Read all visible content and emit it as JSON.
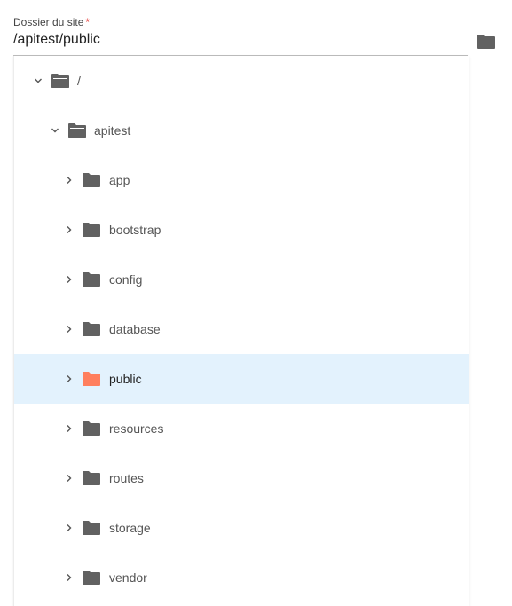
{
  "field": {
    "label": "Dossier du site",
    "required_marker": "*",
    "value": "/apitest/public"
  },
  "browse_button": {
    "icon": "folder-icon"
  },
  "tree": {
    "items": [
      {
        "label": "/",
        "expanded": true,
        "icon": "folder-open-icon",
        "selected": false
      },
      {
        "label": "apitest",
        "expanded": true,
        "icon": "folder-open-icon",
        "selected": false
      },
      {
        "label": "app",
        "expanded": false,
        "icon": "folder-icon",
        "selected": false
      },
      {
        "label": "bootstrap",
        "expanded": false,
        "icon": "folder-icon",
        "selected": false
      },
      {
        "label": "config",
        "expanded": false,
        "icon": "folder-icon",
        "selected": false
      },
      {
        "label": "database",
        "expanded": false,
        "icon": "folder-icon",
        "selected": false
      },
      {
        "label": "public",
        "expanded": false,
        "icon": "folder-icon",
        "selected": true
      },
      {
        "label": "resources",
        "expanded": false,
        "icon": "folder-icon",
        "selected": false
      },
      {
        "label": "routes",
        "expanded": false,
        "icon": "folder-icon",
        "selected": false
      },
      {
        "label": "storage",
        "expanded": false,
        "icon": "folder-icon",
        "selected": false
      },
      {
        "label": "vendor",
        "expanded": false,
        "icon": "folder-icon",
        "selected": false
      }
    ]
  },
  "colors": {
    "folder": "#616161",
    "folder_selected": "#ff7f5e",
    "selected_row": "#e3f2fd",
    "required": "#e53935"
  }
}
